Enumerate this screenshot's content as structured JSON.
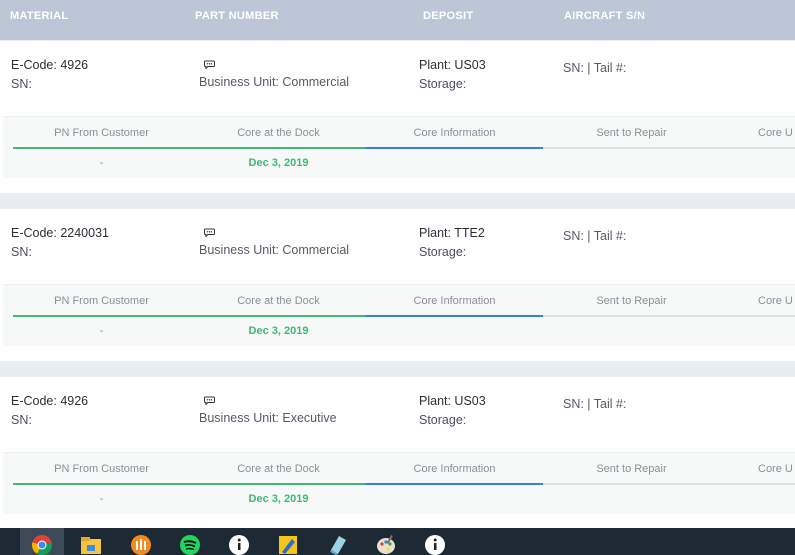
{
  "header": {
    "col_material": "MATERIAL",
    "col_part_number": "PART NUMBER",
    "col_deposit": "DEPOSIT",
    "col_aircraft": "AIRCRAFT S/N"
  },
  "colors": {
    "header_bg": "#bcc6d6",
    "green": "#3fb874",
    "blue": "#3b7fd6"
  },
  "records": [
    {
      "ecode": "E-Code: 4926",
      "sn": "SN:",
      "business_unit": "Business Unit: Commercial",
      "plant": "Plant: US03",
      "storage": "Storage:",
      "sn_tail": "SN: | Tail #:",
      "tabs": [
        "PN From Customer",
        "Core at the Dock",
        "Core Information",
        "Sent to Repair",
        "Core U"
      ],
      "pn_value": "-",
      "dock_date": "Dec 3, 2019"
    },
    {
      "ecode": "E-Code: 2240031",
      "sn": "SN:",
      "business_unit": "Business Unit: Commercial",
      "plant": "Plant: TTE2",
      "storage": "Storage:",
      "sn_tail": "SN: | Tail #:",
      "tabs": [
        "PN From Customer",
        "Core at the Dock",
        "Core Information",
        "Sent to Repair",
        "Core U"
      ],
      "pn_value": "-",
      "dock_date": "Dec 3, 2019"
    },
    {
      "ecode": "E-Code: 4926",
      "sn": "SN:",
      "business_unit": "Business Unit: Executive",
      "plant": "Plant: US03",
      "storage": "Storage:",
      "sn_tail": "SN: | Tail #:",
      "tabs": [
        "PN From Customer",
        "Core at the Dock",
        "Core Information",
        "Sent to Repair",
        "Core U"
      ],
      "pn_value": "-",
      "dock_date": "Dec 3, 2019"
    }
  ],
  "taskbar": {
    "icons": [
      "chrome-icon",
      "file-explorer-icon",
      "orange-app-icon",
      "spotify-icon",
      "jitsi-icon",
      "sticky-app-icon",
      "notepad-app-icon",
      "paint-icon",
      "jitsi-icon-2"
    ]
  }
}
